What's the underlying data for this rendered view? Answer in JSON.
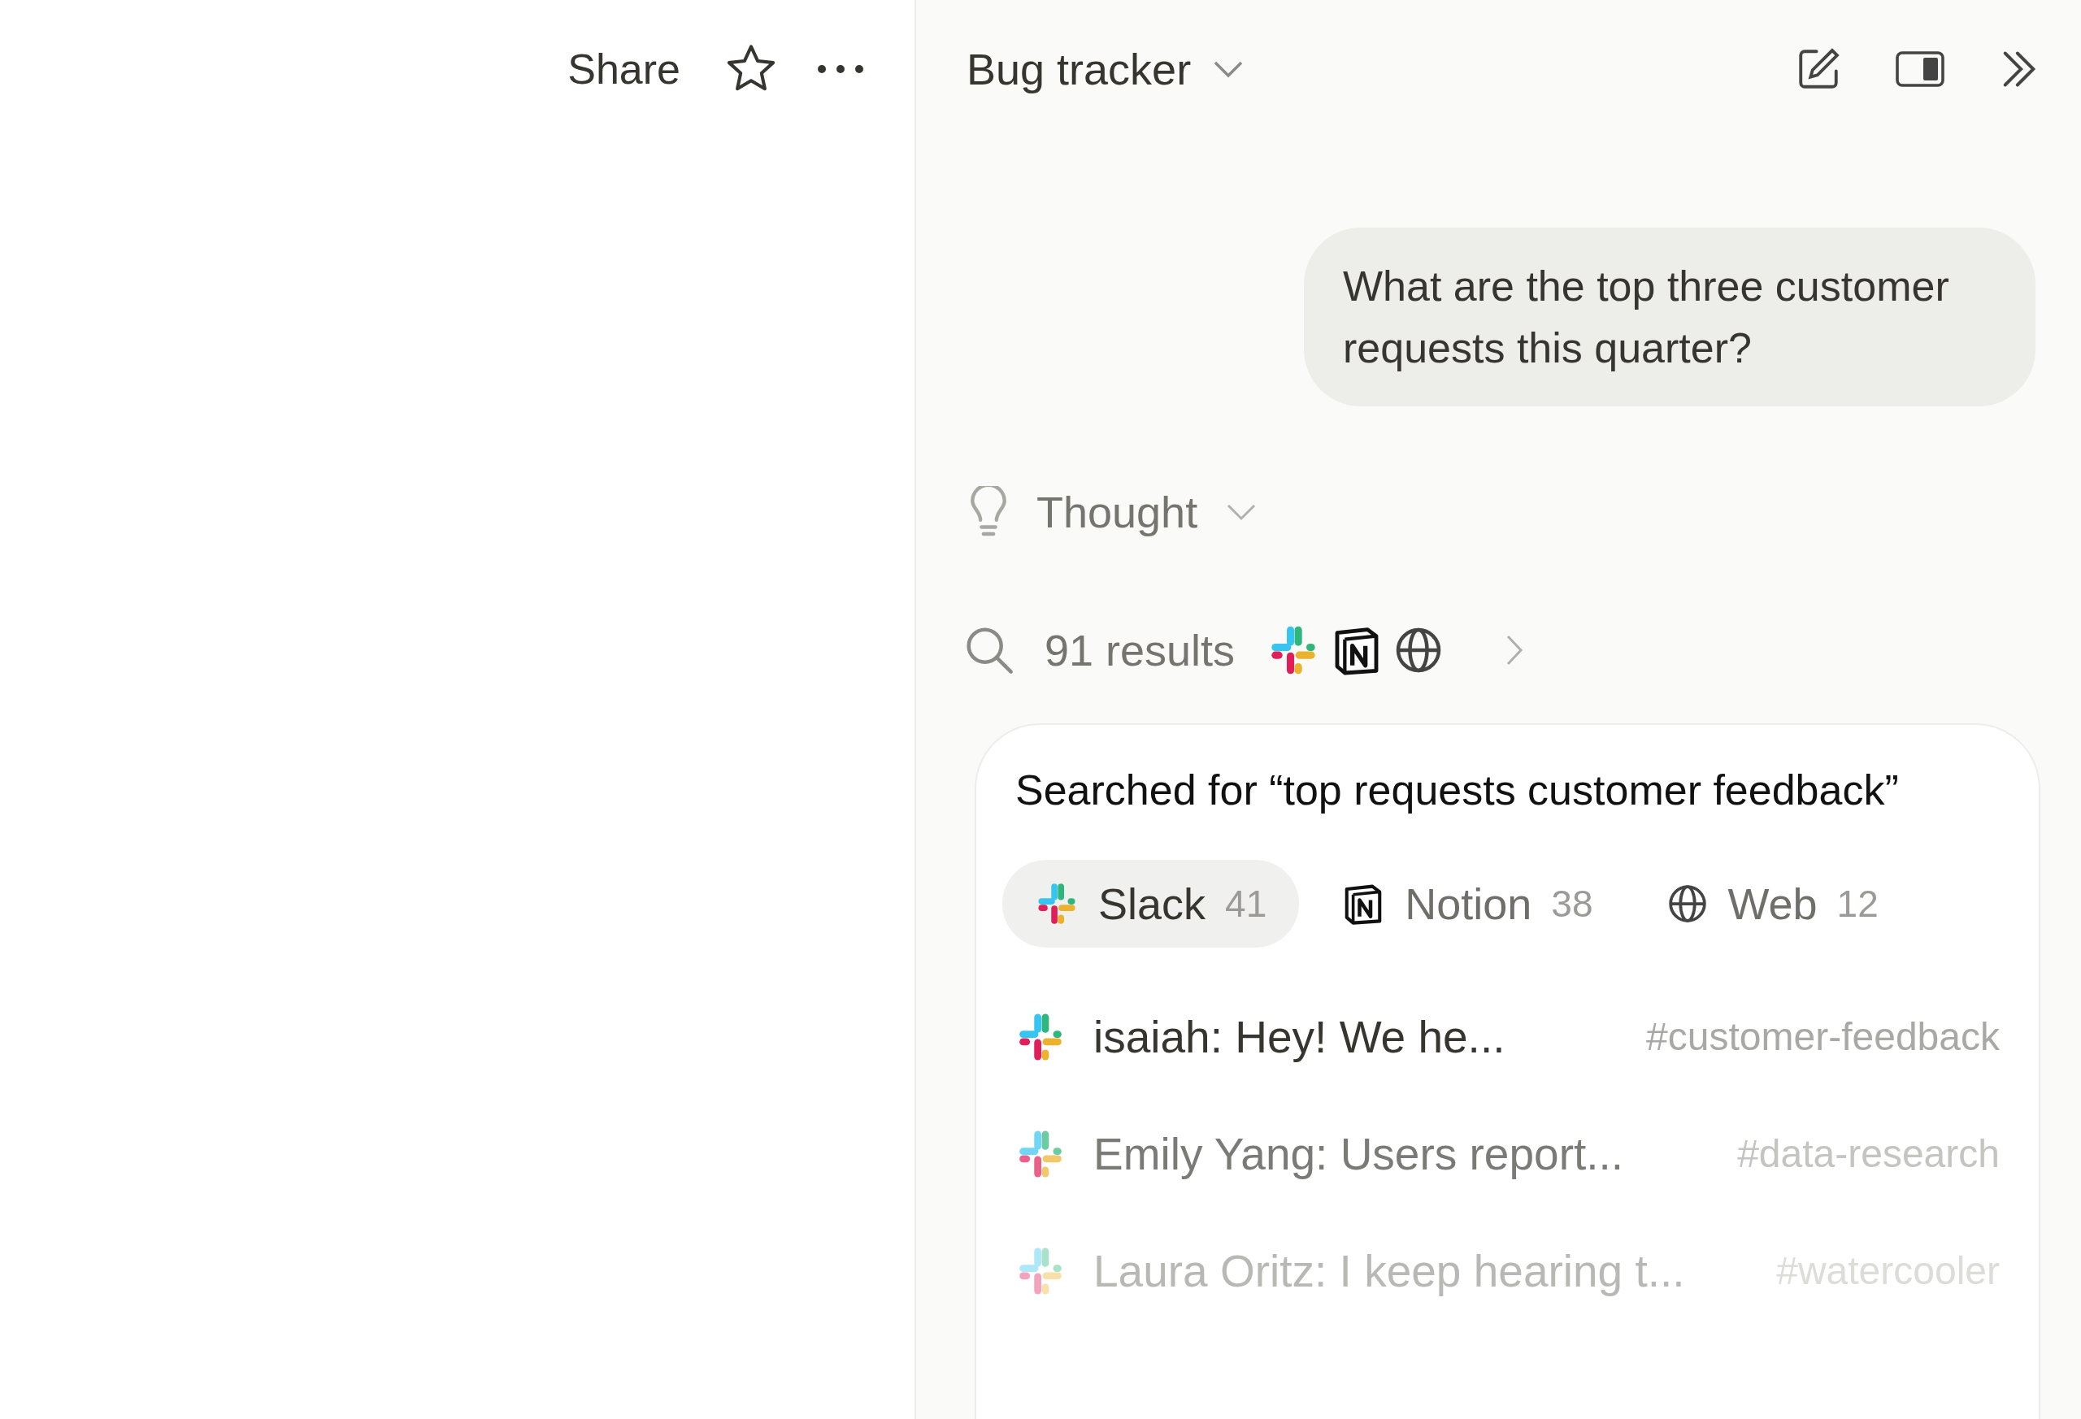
{
  "page_header": {
    "share_label": "Share"
  },
  "chat_header": {
    "title": "Bug tracker"
  },
  "user_message": "What are the top three customer requests this quarter?",
  "thought": {
    "label": "Thought",
    "expanded": false
  },
  "results": {
    "label": "91 results",
    "sources": [
      {
        "kind": "slack"
      },
      {
        "kind": "notion"
      },
      {
        "kind": "web"
      }
    ]
  },
  "search_card": {
    "title": "Searched for “top requests customer feedback”",
    "tabs": [
      {
        "kind": "slack",
        "label": "Slack",
        "count": "41",
        "selected": true
      },
      {
        "kind": "notion",
        "label": "Notion",
        "count": "38",
        "selected": false
      },
      {
        "kind": "web",
        "label": "Web",
        "count": "12",
        "selected": false
      }
    ],
    "rows": [
      {
        "kind": "slack",
        "text": "isaiah: Hey! We he...",
        "channel": "#customer-feedback"
      },
      {
        "kind": "slack",
        "text": "Emily Yang: Users report...",
        "channel": "#data-research"
      },
      {
        "kind": "slack",
        "text": "Laura Oritz: I keep hearing t...",
        "channel": "#watercooler"
      }
    ]
  }
}
